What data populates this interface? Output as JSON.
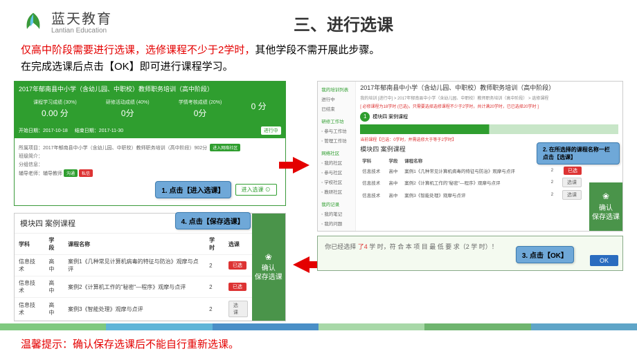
{
  "logo": {
    "cn": "蓝天教育",
    "en": "Lantian Education"
  },
  "title": "三、进行选课",
  "intro": {
    "red": "仅高中阶段需要进行选课，选修课程不少于2学时，",
    "black": "其他学段不需开展此步骤。",
    "line2": "在完成选课后点击【OK】即可进行课程学习。"
  },
  "panel1": {
    "head": "2017年郁南县中小学（含幼儿园、中职校）教师职务培训（高中阶段）",
    "stats": [
      {
        "lbl": "课程学习成绩 (30%)",
        "val": "0.00 分"
      },
      {
        "lbl": "研修活动成绩 (40%)",
        "val": "0分"
      },
      {
        "lbl": "学情考核成绩 (20%)",
        "val": "0分"
      },
      {
        "lbl": "",
        "val": "0 分"
      }
    ],
    "date1": "开始日期：2017-10-18",
    "date2": "结束日期：2017-11-30",
    "status": "进行中",
    "line1": "所属项目：2017年郁南县中小学（含幼儿园、中职校）教师职务培训（高中阶段）902分",
    "line1btn": "进入网络社区",
    "line2": "班级简介：",
    "line3": "分组信息：",
    "line4": "辅导老师：辅导教师",
    "tag1": "沟通",
    "tag2": "私信",
    "callout": "1. 点击【进入选课】",
    "enter": "进入选课 ⊙"
  },
  "panel2": {
    "head": "模块四  案例课程",
    "cols": [
      "学科",
      "学段",
      "课程名称",
      "学时",
      "选课"
    ],
    "rows": [
      {
        "a": "信息技术",
        "b": "高中",
        "c": "案例1《几种常见计算机病毒的特征与防治》观摩与点评",
        "d": "2",
        "sel": true,
        "btn": "已选"
      },
      {
        "a": "信息技术",
        "b": "高中",
        "c": "案例2《计算机工作的\"秘密\"—程序》观摩与点评",
        "d": "2",
        "sel": true,
        "btn": "已选"
      },
      {
        "a": "信息技术",
        "b": "高中",
        "c": "案例3《智能处理》观摩与点评",
        "d": "2",
        "sel": false,
        "btn": "选课"
      }
    ],
    "confirm1": "确认",
    "confirm2": "保存选课",
    "callout": "4. 点击【保存选课】"
  },
  "panel3": {
    "side": [
      "我的培训列表",
      "进行中",
      "已结束",
      "",
      "研修工作坊",
      " ◦ 参与工作坊",
      " ◦ 管理工作坊",
      "",
      "网络社区",
      " ◦ 我的社区",
      " ◦ 参与社区",
      " ◦ 学校社区",
      " ◦ 教研社区",
      "",
      "我的记录",
      " ◦ 我的笔记",
      " ◦ 我的问题"
    ],
    "title": "2017年郁南县中小学（含幼儿园、中职校）教师职务培训（高中阶段）",
    "bc": "我的培训 [进行中] > 2017年郁南县中小学（含幼儿园、中职校）教师职务培训（高中阶段） > 选修课程",
    "note": "[ 必修课程为18学时 (已选)，只需要选择选修课程不少于2学时，共计满20学时，已已选择20学时 ]",
    "step": "模块四 案例课程",
    "sub": "当前课程【已选：0学时，并需选修大于等于2学时】",
    "mod": "模块四  案例课程",
    "cols": [
      "学科",
      "学段",
      "课程名称",
      "学时",
      "选课"
    ],
    "rows": [
      {
        "a": "信息技术",
        "b": "高中",
        "c": "案例1《几种常见计算机病毒的特征与防治》观摩与点评",
        "d": "2",
        "btn": "已选"
      },
      {
        "a": "信息技术",
        "b": "高中",
        "c": "案例2《计算机工作的\"秘密\"—程序》观摩与点评",
        "d": "2",
        "btn": "选课"
      },
      {
        "a": "信息技术",
        "b": "高中",
        "c": "案例3《智能处理》观摩与点评",
        "d": "2",
        "btn": "选课"
      }
    ],
    "callout": "2. 在所选择的课程名称一栏点击【选课】",
    "confirm1": "确认",
    "confirm2": "保存选课"
  },
  "panel4": {
    "t1": "你已经选择",
    "t2": "了4",
    "t3": "学 时，符 合 本 项 目 最 低 要 求（2 学 时）！",
    "ok": "OK",
    "callout": "3. 点击【OK】"
  },
  "tip": "温馨提示：确认保存选课后不能自行重新选课。"
}
